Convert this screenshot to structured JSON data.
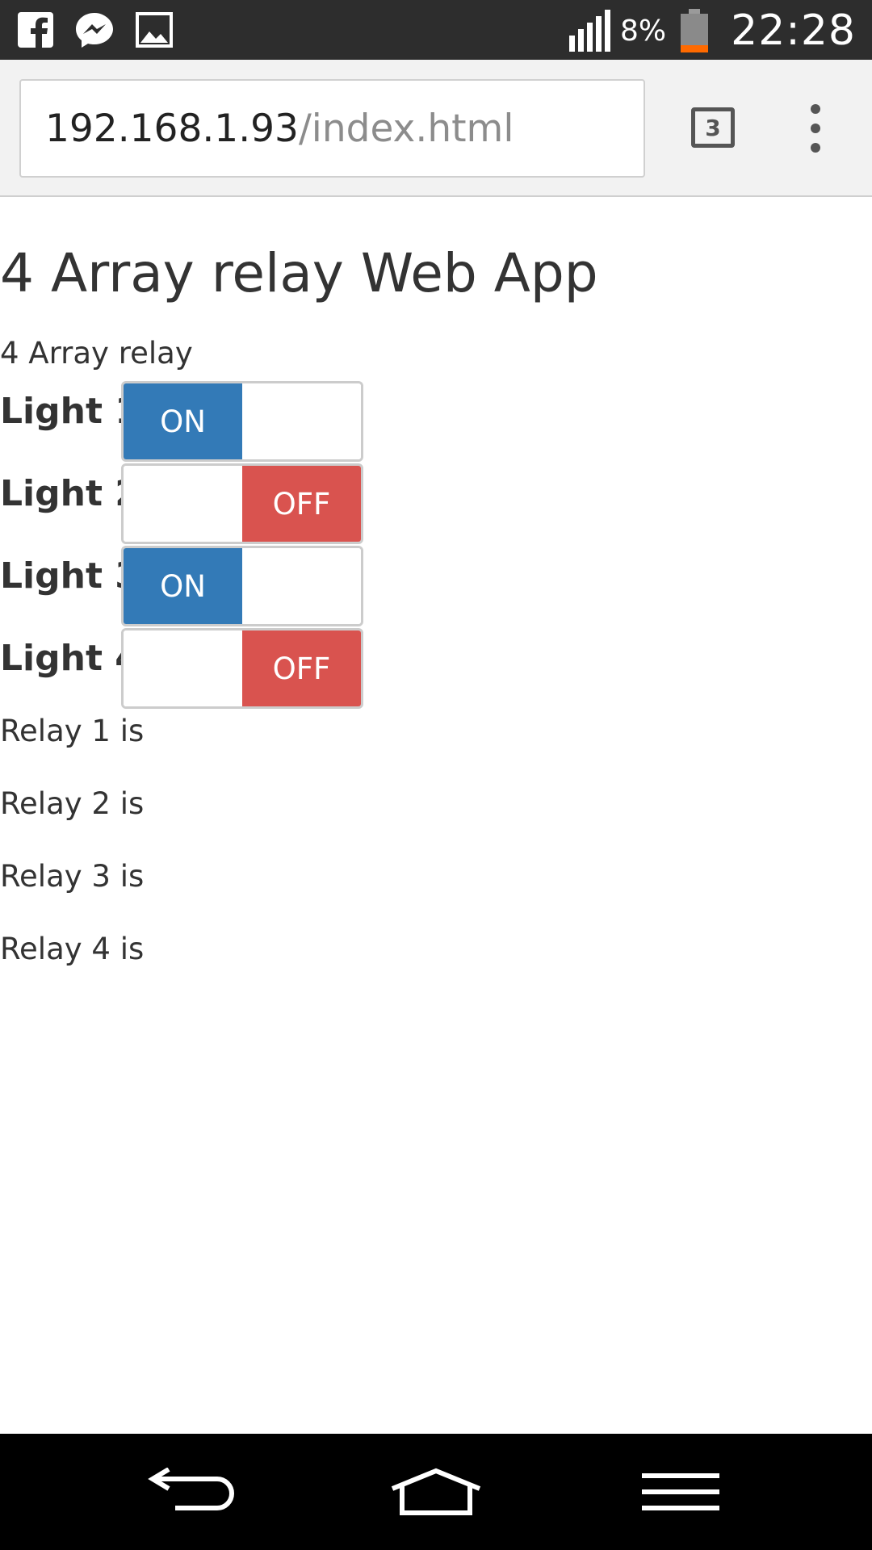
{
  "status_bar": {
    "battery_percent": "8%",
    "time": "22:28",
    "icons": [
      "facebook-icon",
      "messenger-icon",
      "gallery-icon",
      "signal-icon",
      "battery-icon"
    ]
  },
  "browser": {
    "url_host": "192.168.1.93",
    "url_path": "/index.html",
    "tab_count": "3"
  },
  "page": {
    "title": "4 Array relay Web App",
    "subtitle": "4 Array relay",
    "lights": [
      {
        "label": "Light 1",
        "state": "ON"
      },
      {
        "label": "Light 2",
        "state": "OFF"
      },
      {
        "label": "Light 3",
        "state": "ON"
      },
      {
        "label": "Light 4",
        "state": "OFF"
      }
    ],
    "relays": [
      "Relay 1 is",
      "Relay 2 is",
      "Relay 3 is",
      "Relay 4 is"
    ]
  },
  "colors": {
    "on": "#337ab7",
    "off": "#d9534f",
    "status_bar": "#2d2d2d",
    "battery_low": "#ff6a00"
  }
}
